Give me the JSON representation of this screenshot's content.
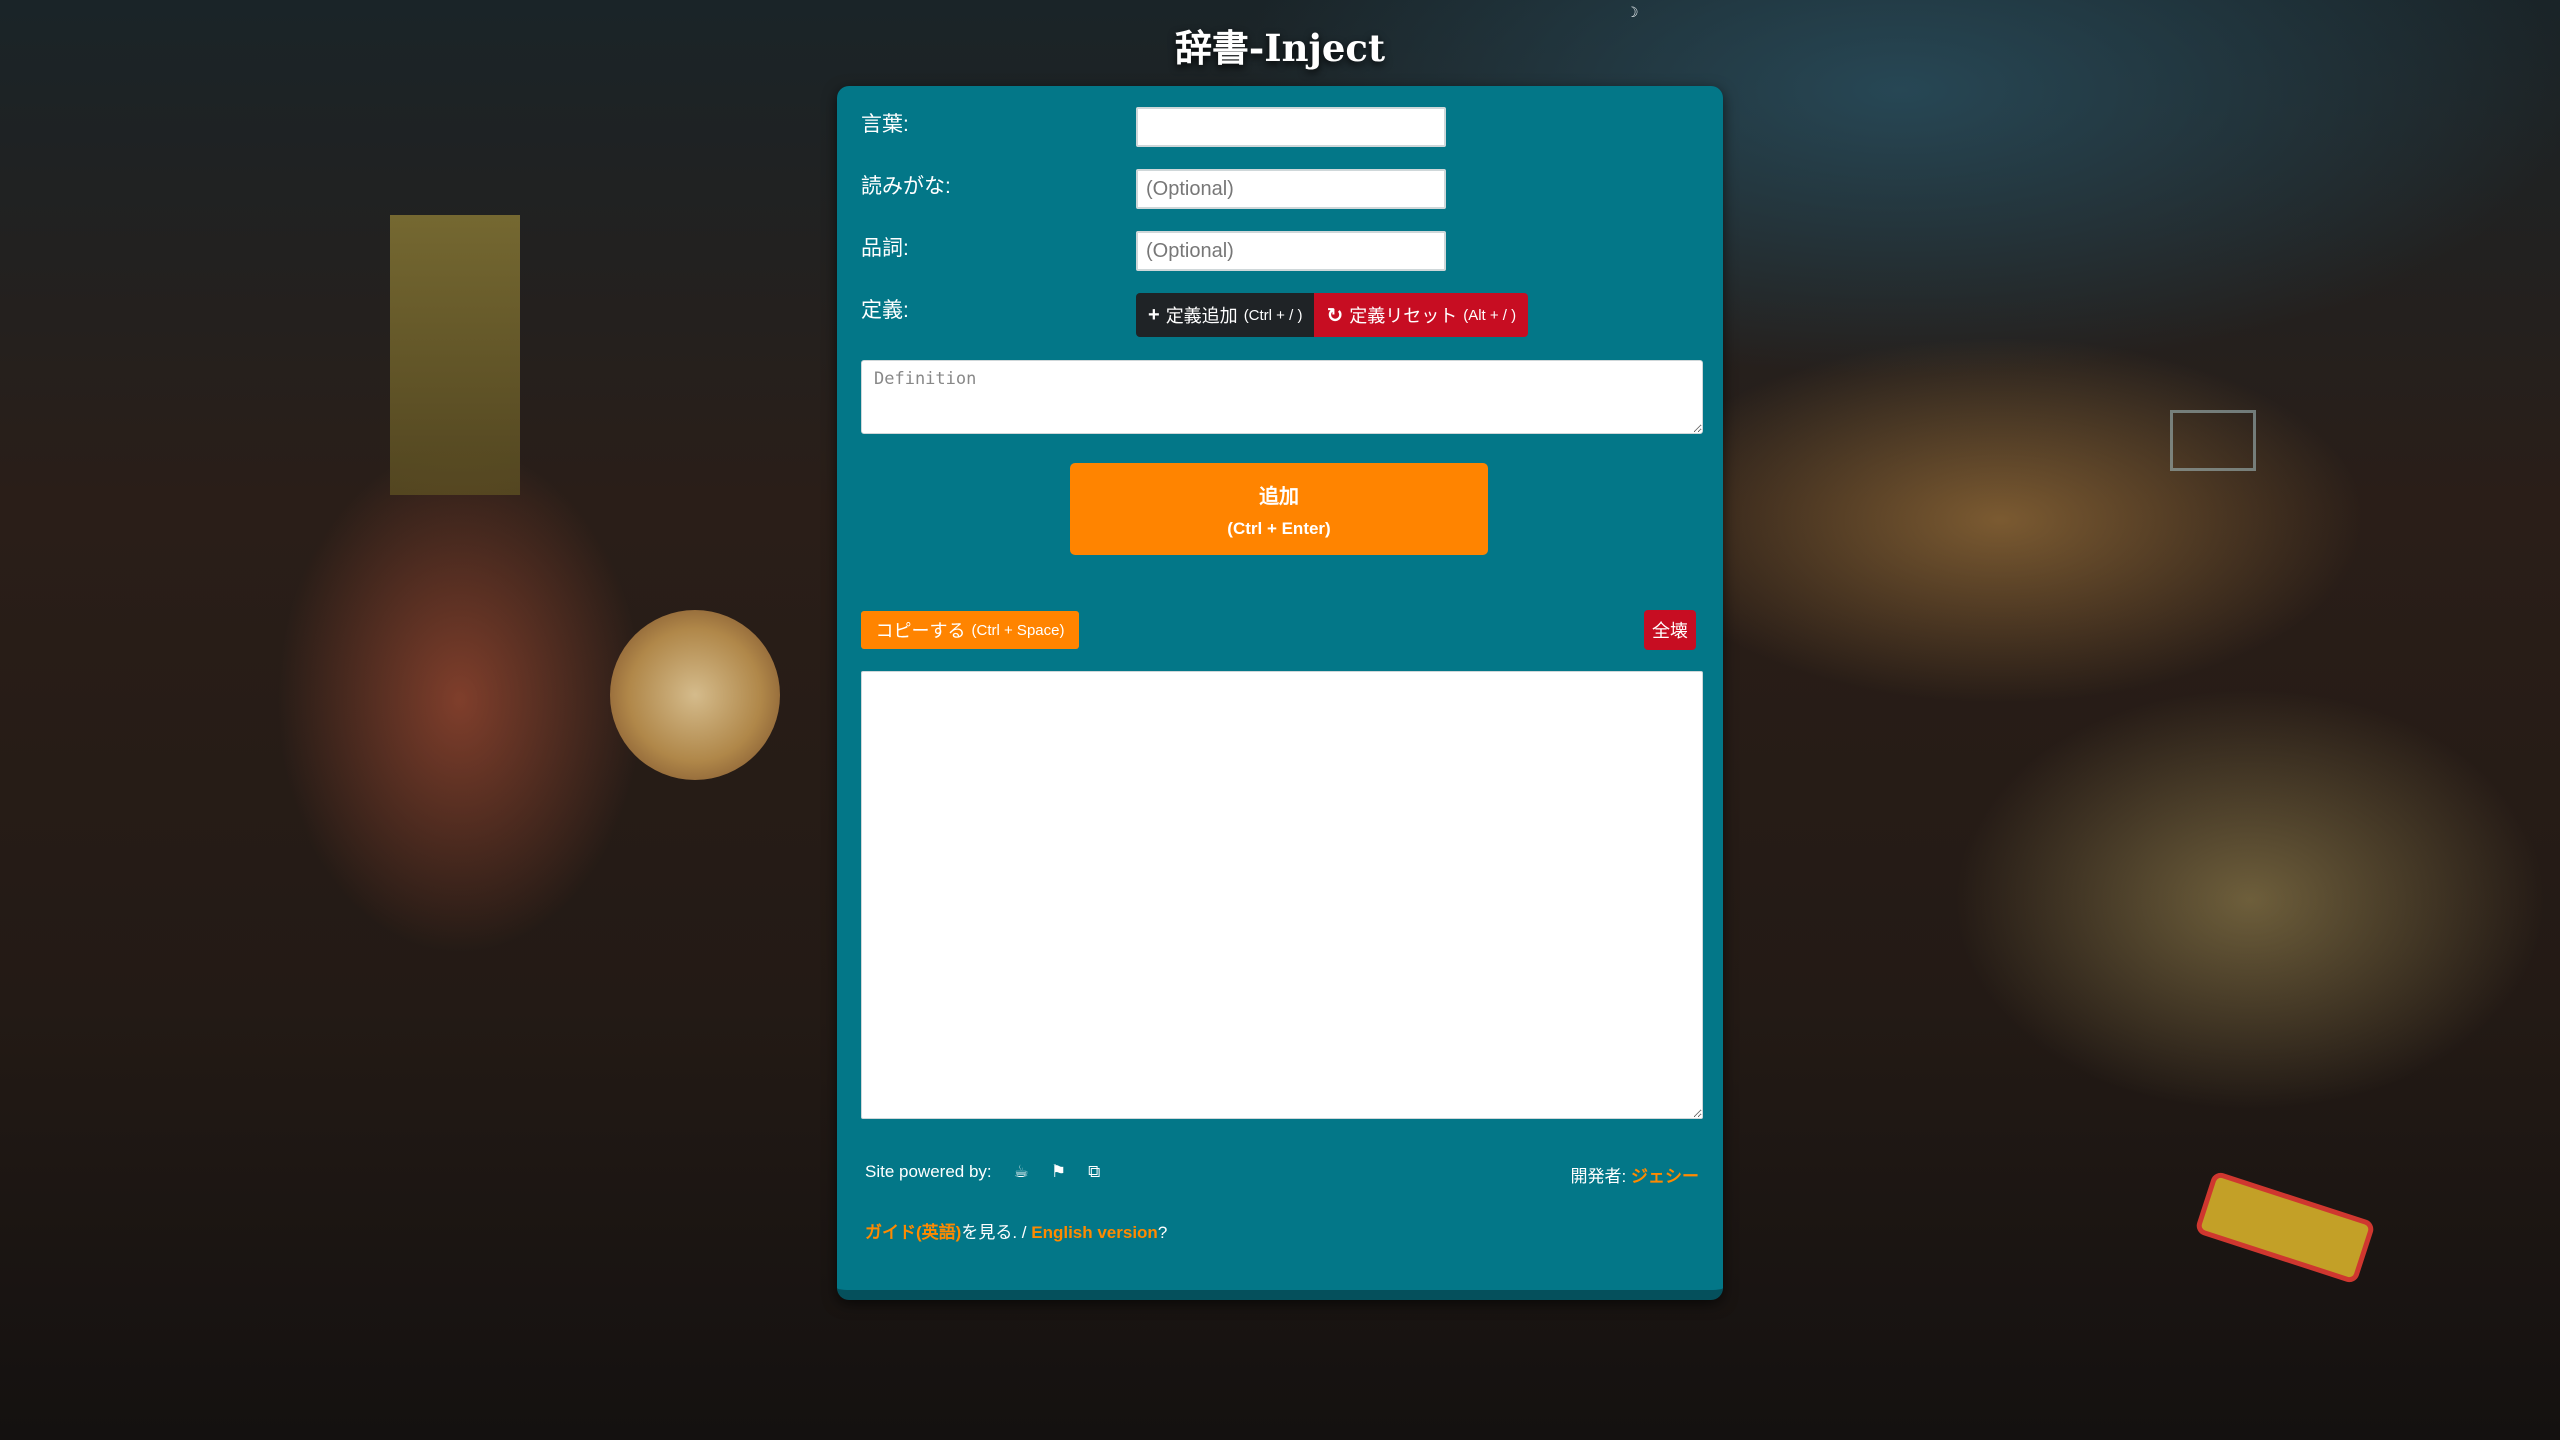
{
  "app": {
    "title": "辞書-Inject"
  },
  "form": {
    "word_label": "言葉:",
    "word_value": "",
    "reading_label": "読みがな:",
    "reading_placeholder": "(Optional)",
    "pos_label": "品詞:",
    "pos_placeholder": "(Optional)",
    "definition_label": "定義:",
    "add_definition_label": "定義追加",
    "add_definition_shortcut": "(Ctrl + / )",
    "reset_definition_label": "定義リセット",
    "reset_definition_shortcut": "(Alt + / )",
    "definition_placeholder": "Definition"
  },
  "add_button": {
    "label": "追加",
    "shortcut": "(Ctrl + Enter)"
  },
  "copy_button": {
    "label": "コピーする",
    "shortcut": "(Ctrl + Space)"
  },
  "clear_button": {
    "label": "全壊"
  },
  "output": {
    "value": ""
  },
  "footer": {
    "powered_by": "Site powered by:",
    "icons": [
      "coffee-icon",
      "flag-icon",
      "copy-icon"
    ],
    "developer_label": "開発者:",
    "developer_name": "ジェシー",
    "guide_link": "ガイド(英語)",
    "guide_suffix": "を見る. / ",
    "english_link": "English version",
    "english_suffix": "?"
  },
  "colors": {
    "panel": "#037788",
    "accent_orange": "#ff8400",
    "danger_red": "#c70d22",
    "dark_button": "#1f2326"
  }
}
